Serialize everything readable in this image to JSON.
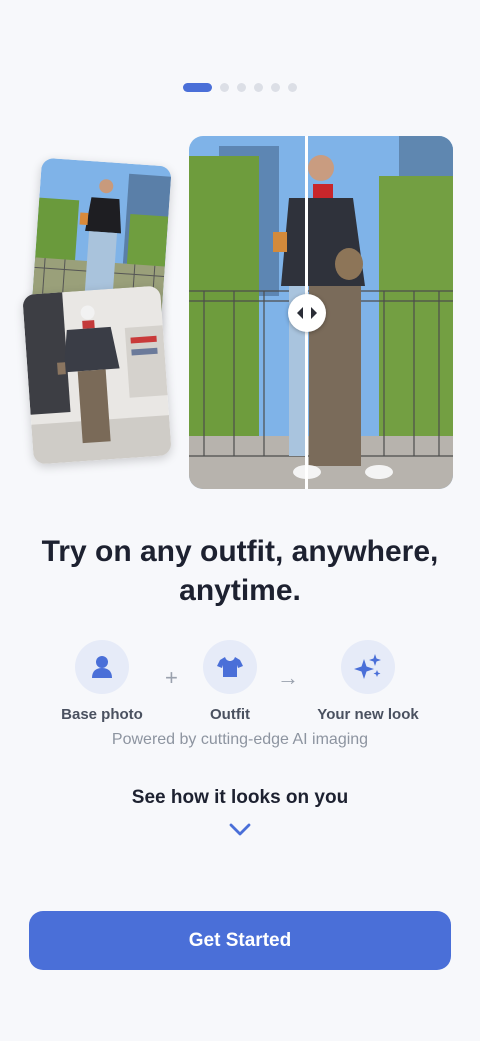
{
  "onboarding": {
    "pager": {
      "total": 6,
      "active_index": 0
    },
    "headline": "Try on any outfit, anywhere, anytime.",
    "steps": [
      {
        "label": "Base photo",
        "icon": "person-icon"
      },
      {
        "label": "Outfit",
        "icon": "tshirt-icon"
      },
      {
        "label": "Your new look",
        "icon": "sparkles-icon"
      }
    ],
    "operators": {
      "plus": "+",
      "arrow": "→"
    },
    "powered_text": "Powered by cutting-edge AI imaging",
    "see_how": "See how it looks on you",
    "cta_label": "Get Started"
  },
  "colors": {
    "accent": "#4a6fd8",
    "background": "#f7f8fb",
    "icon_circle": "#e6ebf8",
    "headline": "#1d2130"
  }
}
